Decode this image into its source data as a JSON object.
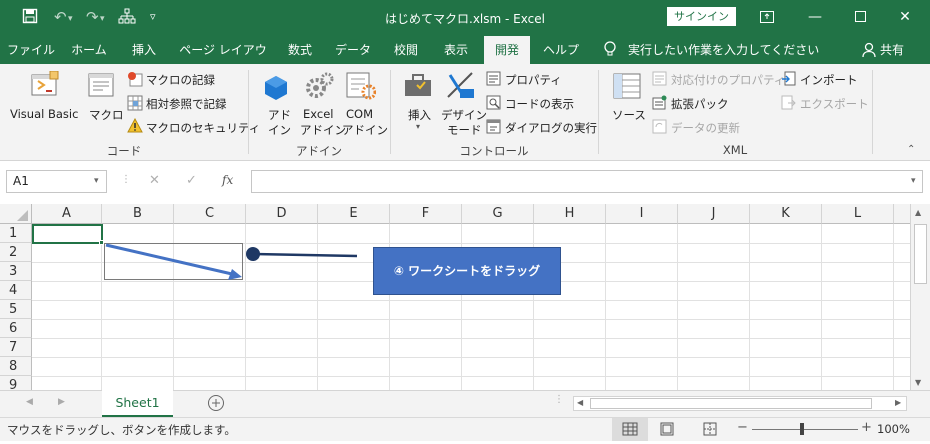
{
  "window": {
    "title": "はじめてマクロ.xlsm  -  Excel",
    "signin_label": "サインイン"
  },
  "tabs": [
    {
      "label": "ファイル"
    },
    {
      "label": "ホーム"
    },
    {
      "label": "挿入"
    },
    {
      "label": "ページ レイアウト"
    },
    {
      "label": "数式"
    },
    {
      "label": "データ"
    },
    {
      "label": "校閲"
    },
    {
      "label": "表示"
    },
    {
      "label": "開発",
      "active": true
    },
    {
      "label": "ヘルプ"
    }
  ],
  "tellme": {
    "text": "実行したい作業を入力してください"
  },
  "share": {
    "label": "共有"
  },
  "ribbon": {
    "code": {
      "group_label": "コード",
      "visual_basic": "Visual Basic",
      "macro": "マクロ",
      "record_macro": "マクロの記録",
      "relative_ref": "相対参照で記録",
      "macro_security": "マクロのセキュリティ"
    },
    "addins": {
      "group_label": "アドイン",
      "addin_l1": "アド",
      "addin_l2": "イン",
      "excel_addin_l1": "Excel",
      "excel_addin_l2": "アドイン",
      "com_addin_l1": "COM",
      "com_addin_l2": "アドイン"
    },
    "controls": {
      "group_label": "コントロール",
      "insert": "挿入",
      "design_l1": "デザイン",
      "design_l2": "モード",
      "properties": "プロパティ",
      "view_code": "コードの表示",
      "run_dialog": "ダイアログの実行"
    },
    "xml": {
      "group_label": "XML",
      "source": "ソース",
      "map_properties": "対応付けのプロパティ",
      "expansion_packs": "拡張パック",
      "refresh_data": "データの更新",
      "import": "インポート",
      "export": "エクスポート"
    }
  },
  "formula_bar": {
    "name_box": "A1",
    "fx": "fx",
    "content": ""
  },
  "grid": {
    "columns": [
      "A",
      "B",
      "C",
      "D",
      "E",
      "F",
      "G",
      "H",
      "I",
      "J",
      "K",
      "L"
    ],
    "rows": [
      "1",
      "2",
      "3",
      "4",
      "5",
      "6",
      "7",
      "8",
      "9"
    ]
  },
  "callout": {
    "text": "④  ワークシートをドラッグ"
  },
  "sheets": [
    {
      "name": "Sheet1",
      "active": true
    }
  ],
  "status": {
    "message": "マウスをドラッグし、ボタンを作成します。",
    "zoom": "100%"
  },
  "colors": {
    "excel_green": "#217346",
    "callout_blue": "#4472c4",
    "arrow_blue": "#4472c4",
    "marker_navy": "#1f3864"
  }
}
